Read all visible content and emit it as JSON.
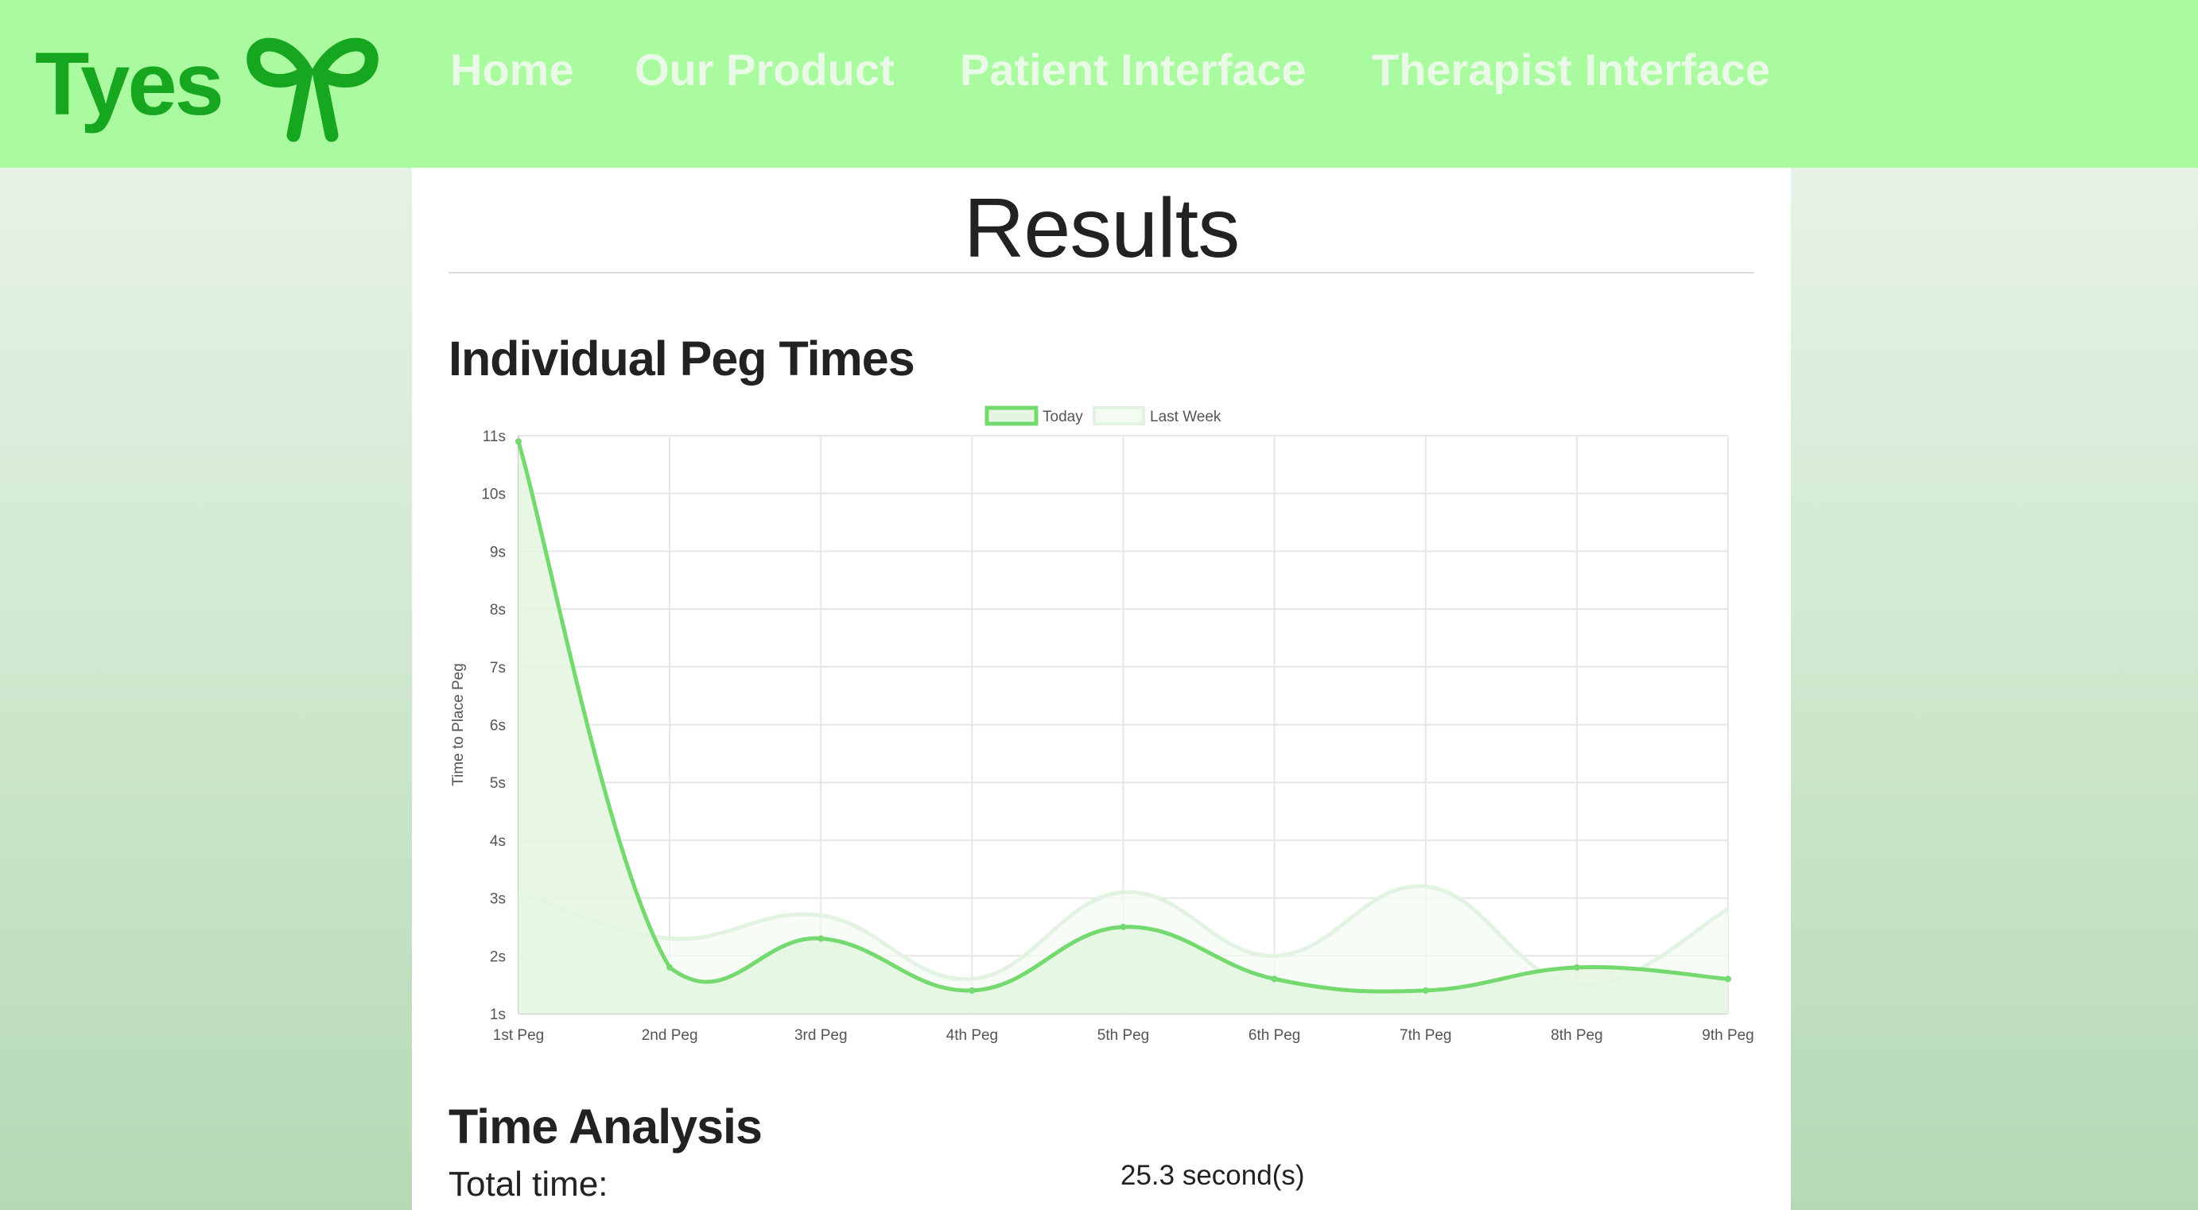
{
  "nav": {
    "brand": "Tyes",
    "links": [
      "Home",
      "Our Product",
      "Patient Interface",
      "Therapist Interface"
    ]
  },
  "colors": {
    "navbar": "#aafaa0",
    "brand": "#17a61f",
    "nav_link": "#e9fbe6",
    "today_line": "#74d96e",
    "today_fill": "#e3f6df",
    "last_week_line": "#e3f3e1",
    "last_week_fill": "#f4fbf3"
  },
  "page": {
    "title": "Results",
    "chart_heading": "Individual Peg Times",
    "analysis_heading": "Time Analysis",
    "total_time_label": "Total time:",
    "total_time_value": "25.3 second(s)"
  },
  "chart_data": {
    "type": "line",
    "categories": [
      "1st Peg",
      "2nd Peg",
      "3rd Peg",
      "4th Peg",
      "5th Peg",
      "6th Peg",
      "7th Peg",
      "8th Peg",
      "9th Peg"
    ],
    "series": [
      {
        "name": "Today",
        "values": [
          10.9,
          1.8,
          2.3,
          1.4,
          2.5,
          1.6,
          1.4,
          1.8,
          1.6
        ]
      },
      {
        "name": "Last Week",
        "values": [
          3.1,
          2.3,
          2.7,
          1.6,
          3.1,
          2.0,
          3.2,
          1.5,
          2.8
        ]
      }
    ],
    "title": "",
    "xlabel": "",
    "ylabel": "Time to Place Peg",
    "y_tick_labels": [
      "1s",
      "2s",
      "3s",
      "4s",
      "5s",
      "6s",
      "7s",
      "8s",
      "9s",
      "10s",
      "11s"
    ],
    "ylim": [
      1,
      11
    ],
    "grid": true,
    "legend_position": "top-center",
    "area_fill": true,
    "smooth": true
  }
}
